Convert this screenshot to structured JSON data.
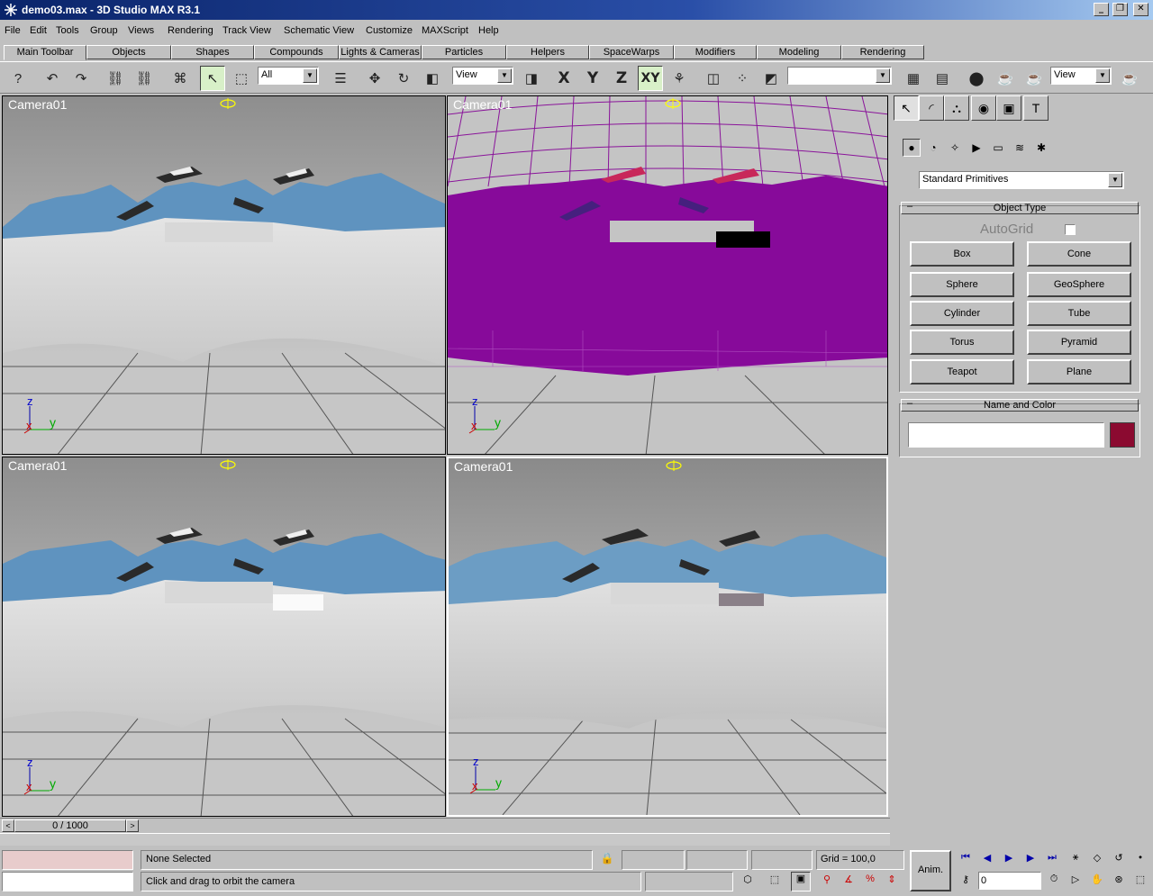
{
  "window": {
    "title": "demo03.max - 3D Studio MAX R3.1"
  },
  "menu": [
    "File",
    "Edit",
    "Tools",
    "Group",
    "Views",
    "Rendering",
    "Track View",
    "Schematic View",
    "Customize",
    "MAXScript",
    "Help"
  ],
  "tabs": [
    "Main Toolbar",
    "Objects",
    "Shapes",
    "Compounds",
    "Lights & Cameras",
    "Particles",
    "Helpers",
    "SpaceWarps",
    "Modifiers",
    "Modeling",
    "Rendering"
  ],
  "toolbar": {
    "selection_filter": "All",
    "reference_coord": "View",
    "named_selection": "",
    "render_type": "View",
    "axis_x": "X",
    "axis_y": "Y",
    "axis_z": "Z",
    "axis_xy": "XY"
  },
  "viewports": [
    {
      "label": "Camera01",
      "mode": "smooth-shaded"
    },
    {
      "label": "Camera01",
      "mode": "wireframe"
    },
    {
      "label": "Camera01",
      "mode": "smooth-shaded"
    },
    {
      "label": "Camera01",
      "mode": "smooth-shaded"
    }
  ],
  "axes": {
    "z": "z",
    "x": "x",
    "y": "y"
  },
  "command_panel": {
    "category": "Standard Primitives",
    "object_type_title": "Object Type",
    "autogrid_label": "AutoGrid",
    "buttons": [
      "Box",
      "Cone",
      "Sphere",
      "GeoSphere",
      "Cylinder",
      "Tube",
      "Torus",
      "Pyramid",
      "Teapot",
      "Plane"
    ],
    "name_color_title": "Name and Color",
    "name_value": "",
    "object_color": "#8b0a30",
    "collapse_glyph": "–"
  },
  "timeline": {
    "position": "0 / 1000",
    "prev": "<",
    "next": ">"
  },
  "status": {
    "selection": "None Selected",
    "prompt": "Click and drag to orbit the camera",
    "grid": "Grid = 100,0",
    "anim_label": "Anim.",
    "frame": "0"
  },
  "colors": {
    "title_bar": "#0a246a",
    "mountain": "#5f93bf",
    "wire": "#8a149a",
    "ship_red": "#c8285a",
    "ship_blue": "#46207e"
  }
}
